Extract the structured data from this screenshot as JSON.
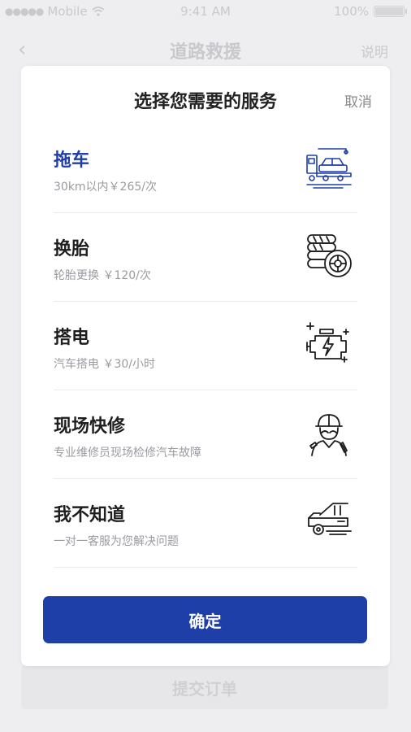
{
  "status_bar": {
    "carrier": "Mobile",
    "time": "9:41 AM",
    "battery": "100%"
  },
  "nav": {
    "back_icon": "‹",
    "title": "道路救援",
    "right": "说明"
  },
  "background": {
    "submit_label": "提交订单"
  },
  "modal": {
    "title": "选择您需要的服务",
    "cancel_label": "取消",
    "confirm_label": "确定",
    "items": [
      {
        "title": "拖车",
        "desc": "30km以内￥265/次",
        "icon": "tow-truck-icon",
        "selected": true
      },
      {
        "title": "换胎",
        "desc": "轮胎更换 ￥120/次",
        "icon": "tire-icon",
        "selected": false
      },
      {
        "title": "搭电",
        "desc": "汽车搭电 ￥30/小时",
        "icon": "engine-battery-icon",
        "selected": false
      },
      {
        "title": "现场快修",
        "desc": "专业维修员现场检修汽车故障",
        "icon": "mechanic-icon",
        "selected": false
      },
      {
        "title": "我不知道",
        "desc": "一对一客服为您解决问题",
        "icon": "car-breakdown-icon",
        "selected": false
      }
    ]
  },
  "colors": {
    "accent": "#1e3ea8",
    "title_text": "#1e1e1e",
    "desc_text": "#9a9aa0"
  }
}
